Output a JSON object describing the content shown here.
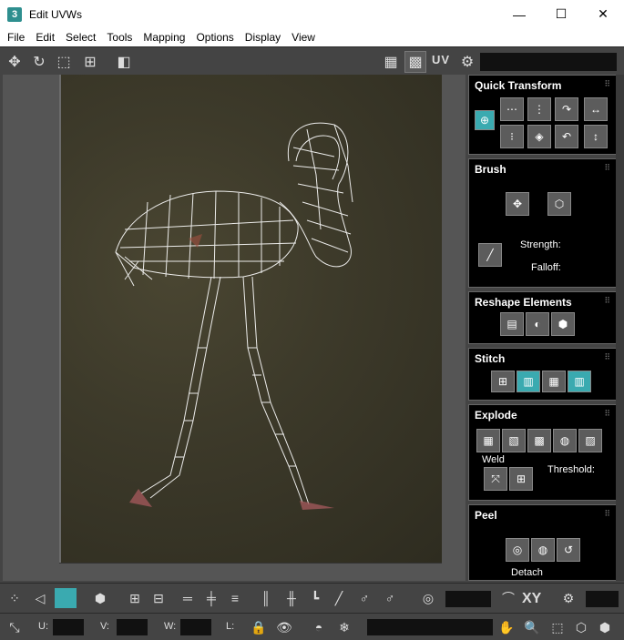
{
  "window": {
    "title": "Edit UVWs",
    "app_icon": "3",
    "minimize": "—",
    "maximize": "☐",
    "close": "✕"
  },
  "menu": [
    "File",
    "Edit",
    "Select",
    "Tools",
    "Mapping",
    "Options",
    "Display",
    "View"
  ],
  "toolbar": {
    "uv_label": "UV"
  },
  "panels": {
    "quick_transform": "Quick Transform",
    "brush": "Brush",
    "strength": "Strength:",
    "falloff": "Falloff:",
    "reshape": "Reshape Elements",
    "stitch": "Stitch",
    "explode": "Explode",
    "weld": "Weld",
    "threshold": "Threshold:",
    "peel": "Peel",
    "detach": "Detach"
  },
  "bottom": {
    "xy_label": "XY",
    "u_label": "U:",
    "v_label": "V:",
    "w_label": "W:",
    "l_label": "L:"
  },
  "colors": {
    "accent": "#3aaab0",
    "panel_bg": "#000000",
    "ui_bg": "#444444"
  }
}
